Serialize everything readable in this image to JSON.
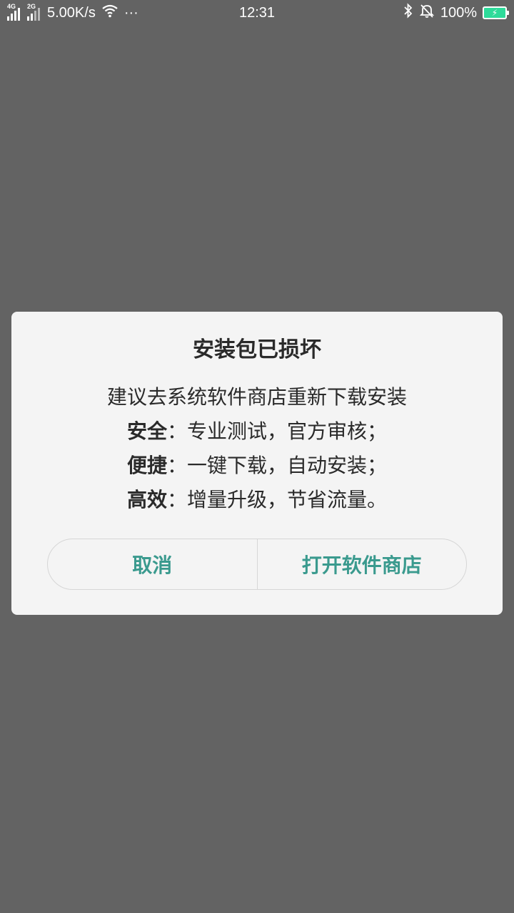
{
  "status_bar": {
    "sim1_label": "4G",
    "sim2_label": "2G",
    "net_speed": "5.00K/s",
    "more": "···",
    "time": "12:31",
    "battery": "100%"
  },
  "dialog": {
    "title": "安装包已损坏",
    "intro": "建议去系统软件商店重新下载安装",
    "features": [
      {
        "label": "安全",
        "sep": "：",
        "text": "专业测试，官方审核；"
      },
      {
        "label": "便捷",
        "sep": "：",
        "text": "一键下载，自动安装；"
      },
      {
        "label": "高效",
        "sep": "：",
        "text": "增量升级，节省流量。"
      }
    ],
    "cancel_label": "取消",
    "confirm_label": "打开软件商店"
  },
  "colors": {
    "overlay": "#636363",
    "dialog_bg": "#f4f4f4",
    "accent": "#3a9a8e",
    "battery": "#2edb9a"
  }
}
